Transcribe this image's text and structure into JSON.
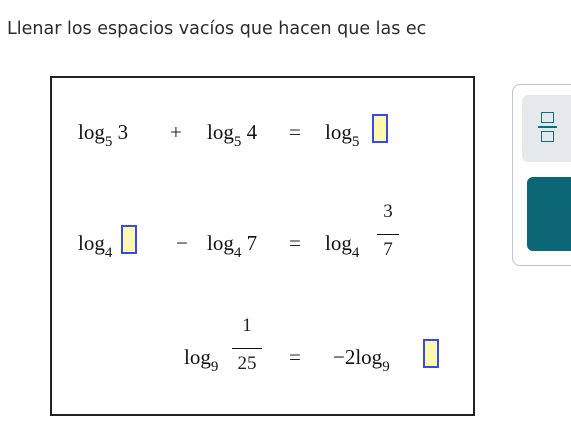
{
  "instruction": "Llenar los espacios vacíos que hacen que las ec",
  "equations": {
    "eq1": {
      "lhs1_base": "5",
      "lhs1_arg": "3",
      "op": "+",
      "lhs2_base": "5",
      "lhs2_arg": "4",
      "eq": "=",
      "rhs_base": "5"
    },
    "eq2": {
      "lhs1_base": "4",
      "op": "−",
      "lhs2_base": "4",
      "lhs2_arg": "7",
      "eq": "=",
      "rhs_base": "4",
      "rhs_num": "3",
      "rhs_den": "7"
    },
    "eq3": {
      "lhs_base": "9",
      "lhs_num": "1",
      "lhs_den": "25",
      "eq": "=",
      "rhs_coef": "−2",
      "rhs_base": "9"
    }
  },
  "log_word": "log",
  "toolbar": {
    "fraction_icon": "fraction-icon",
    "accent": "#0d6676",
    "button_bg": "#e6e9eb",
    "blank_fill": "#fff9b0",
    "blank_border": "#3b49e0"
  }
}
